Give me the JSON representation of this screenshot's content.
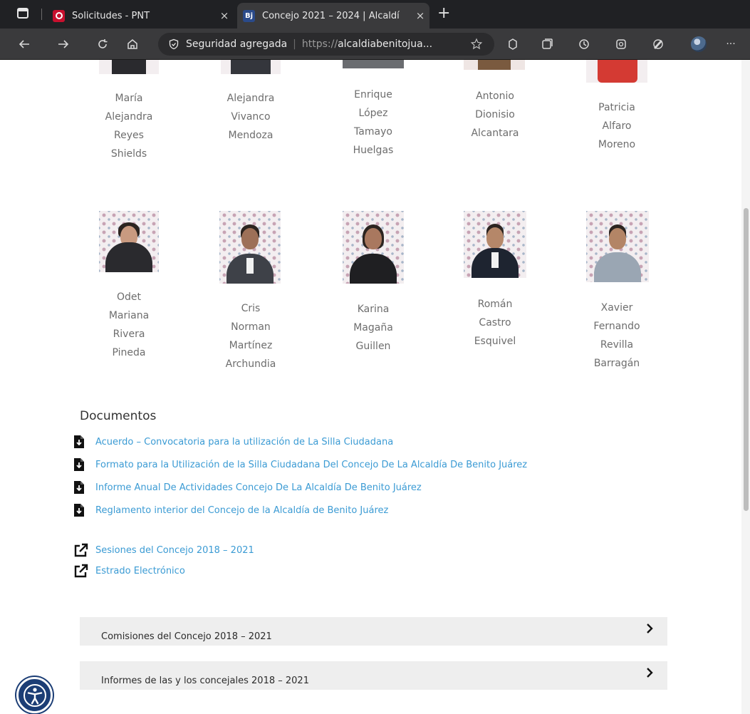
{
  "browser": {
    "tabs": [
      {
        "title": "Solicitudes - PNT",
        "active": false
      },
      {
        "title": "Concejo 2021 – 2024 | Alcaldí",
        "active": true
      }
    ],
    "close_glyph": "×",
    "new_tab_glyph": "+",
    "security_label": "Seguridad agregada",
    "url_proto": "https://",
    "url_host": "alcaldiabenitojua...",
    "more_glyph": "···"
  },
  "members_row1": [
    {
      "lines": [
        "María",
        "Alejandra",
        "Reyes",
        "Shields"
      ]
    },
    {
      "lines": [
        "Alejandra",
        "Vivanco",
        "Mendoza"
      ]
    },
    {
      "lines": [
        "Enrique",
        "López",
        "Tamayo",
        "Huelgas"
      ]
    },
    {
      "lines": [
        "Antonio",
        "Dionisio",
        "Alcantara"
      ]
    },
    {
      "lines": [
        "Patricia",
        "Alfaro",
        "Moreno"
      ]
    }
  ],
  "members_row2": [
    {
      "lines": [
        "Odet",
        "Mariana",
        "Rivera",
        "Pineda"
      ]
    },
    {
      "lines": [
        "Cris",
        "Norman",
        "Martínez",
        "Archundia"
      ]
    },
    {
      "lines": [
        "Karina",
        "Magaña",
        "Guillen"
      ]
    },
    {
      "lines": [
        "Román",
        "Castro",
        "Esquivel"
      ]
    },
    {
      "lines": [
        "Xavier",
        "Fernando",
        "Revilla",
        "Barragán"
      ]
    }
  ],
  "documents": {
    "title": "Documentos",
    "files": [
      "Acuerdo – Convocatoria para la utilización de La Silla Ciudadana",
      "Formato para la Utilización de la Silla Ciudadana Del Concejo De La Alcaldía De Benito Juárez",
      "Informe Anual De Actividades Concejo De La Alcaldía De Benito Juárez",
      "Reglamento interior del Concejo de la Alcaldía de Benito Juárez"
    ],
    "external_links": [
      "Sesiones del Concejo 2018 – 2021",
      "Estrado Electrónico"
    ]
  },
  "accordions": [
    "Comisiones del Concejo 2018 – 2021",
    "Informes de las y los concejales 2018 – 2021"
  ],
  "colors": {
    "link": "#3b9bd4",
    "accordion_bg": "#eeeeee",
    "a11y_button": "#1b3d75"
  }
}
